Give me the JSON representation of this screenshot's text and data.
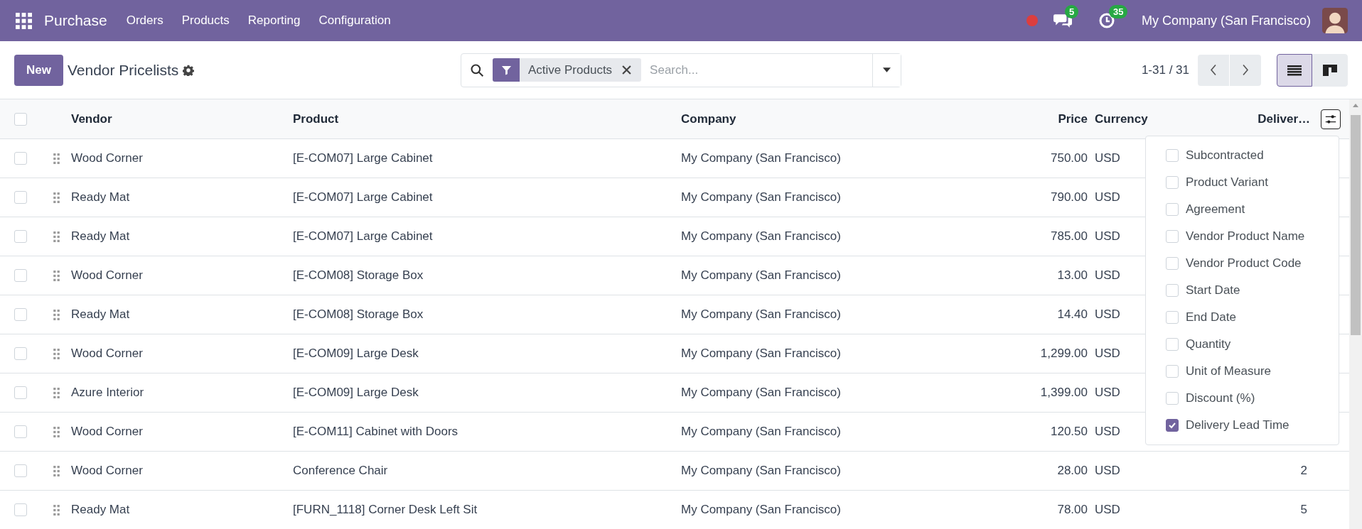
{
  "app": {
    "name": "Purchase",
    "menu": [
      "Orders",
      "Products",
      "Reporting",
      "Configuration"
    ]
  },
  "systray": {
    "messages_count": "5",
    "activities_count": "35",
    "company": "My Company (San Francisco)"
  },
  "control_panel": {
    "new_button": "New",
    "title": "Vendor Pricelists",
    "search": {
      "facets": [
        {
          "label": "Active Products"
        }
      ],
      "placeholder": "Search..."
    },
    "pager": "1-31 / 31",
    "views": [
      {
        "kind": "list",
        "selected": true
      },
      {
        "kind": "kanban",
        "selected": false
      }
    ]
  },
  "table": {
    "select_all_checked": false,
    "columns": [
      "Vendor",
      "Product",
      "Company",
      "Price",
      "Currency",
      "Deliver…"
    ],
    "rows": [
      {
        "checked": false,
        "vendor": "Wood Corner",
        "product": "[E-COM07] Large Cabinet",
        "company": "My Company (San Francisco)",
        "price": "750.00",
        "currency": "USD"
      },
      {
        "checked": false,
        "vendor": "Ready Mat",
        "product": "[E-COM07] Large Cabinet",
        "company": "My Company (San Francisco)",
        "price": "790.00",
        "currency": "USD"
      },
      {
        "checked": false,
        "vendor": "Ready Mat",
        "product": "[E-COM07] Large Cabinet",
        "company": "My Company (San Francisco)",
        "price": "785.00",
        "currency": "USD"
      },
      {
        "checked": false,
        "vendor": "Wood Corner",
        "product": "[E-COM08] Storage Box",
        "company": "My Company (San Francisco)",
        "price": "13.00",
        "currency": "USD"
      },
      {
        "checked": false,
        "vendor": "Ready Mat",
        "product": "[E-COM08] Storage Box",
        "company": "My Company (San Francisco)",
        "price": "14.40",
        "currency": "USD"
      },
      {
        "checked": false,
        "vendor": "Wood Corner",
        "product": "[E-COM09] Large Desk",
        "company": "My Company (San Francisco)",
        "price": "1,299.00",
        "currency": "USD"
      },
      {
        "checked": false,
        "vendor": "Azure Interior",
        "product": "[E-COM09] Large Desk",
        "company": "My Company (San Francisco)",
        "price": "1,399.00",
        "currency": "USD"
      },
      {
        "checked": false,
        "vendor": "Wood Corner",
        "product": "[E-COM11] Cabinet with Doors",
        "company": "My Company (San Francisco)",
        "price": "120.50",
        "currency": "USD"
      },
      {
        "checked": false,
        "vendor": "Wood Corner",
        "product": "Conference Chair",
        "company": "My Company (San Francisco)",
        "price": "28.00",
        "currency": "USD",
        "lead_time": "2"
      },
      {
        "checked": false,
        "vendor": "Ready Mat",
        "product": "[FURN_1118] Corner Desk Left Sit",
        "company": "My Company (San Francisco)",
        "price": "78.00",
        "currency": "USD",
        "lead_time": "5"
      }
    ]
  },
  "optional_columns": {
    "open": true,
    "items": [
      {
        "label": "Subcontracted",
        "checked": false
      },
      {
        "label": "Product Variant",
        "checked": false
      },
      {
        "label": "Agreement",
        "checked": false
      },
      {
        "label": "Vendor Product Name",
        "checked": false
      },
      {
        "label": "Vendor Product Code",
        "checked": false
      },
      {
        "label": "Start Date",
        "checked": false
      },
      {
        "label": "End Date",
        "checked": false
      },
      {
        "label": "Quantity",
        "checked": false
      },
      {
        "label": "Unit of Measure",
        "checked": false
      },
      {
        "label": "Discount (%)",
        "checked": false
      },
      {
        "label": "Delivery Lead Time",
        "checked": true
      }
    ]
  }
}
